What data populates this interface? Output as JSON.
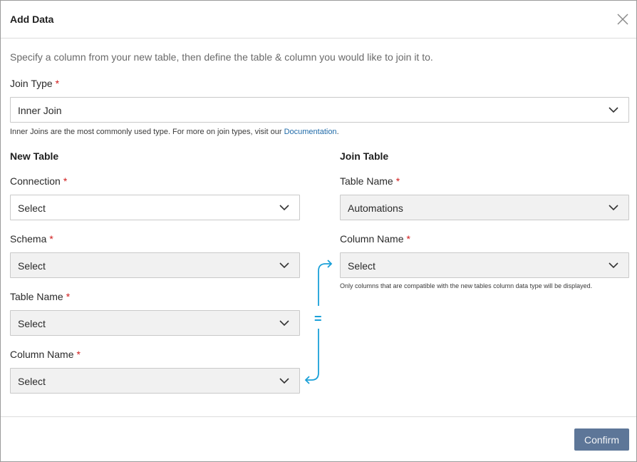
{
  "dialog": {
    "title": "Add Data",
    "intro": "Specify a column from your new table, then define the table & column you would like to join it to."
  },
  "join_type": {
    "label": "Join Type",
    "required_mark": "*",
    "value": "Inner Join",
    "help_text": "Inner Joins are the most commonly used type. For more on join types, visit our ",
    "help_link": "Documentation",
    "help_suffix": "."
  },
  "new_table": {
    "title": "New Table",
    "connection": {
      "label": "Connection",
      "required_mark": "*",
      "value": "Select"
    },
    "schema": {
      "label": "Schema",
      "required_mark": "*",
      "value": "Select"
    },
    "table_name": {
      "label": "Table Name",
      "required_mark": "*",
      "value": "Select"
    },
    "column_name": {
      "label": "Column Name",
      "required_mark": "*",
      "value": "Select"
    }
  },
  "join_table": {
    "title": "Join Table",
    "table_name": {
      "label": "Table Name",
      "required_mark": "*",
      "value": "Automations"
    },
    "column_name": {
      "label": "Column Name",
      "required_mark": "*",
      "value": "Select"
    },
    "note": "Only columns that are compatible with the new tables column data type will be displayed."
  },
  "connector": {
    "symbol": "=",
    "color": "#1aa0d8"
  },
  "footer": {
    "confirm_label": "Confirm"
  },
  "colors": {
    "accent": "#5d7698",
    "link": "#1f6aa8",
    "required": "#d01c1c"
  },
  "icons": {
    "close": "close-icon",
    "chevron": "chevron-down-icon"
  }
}
